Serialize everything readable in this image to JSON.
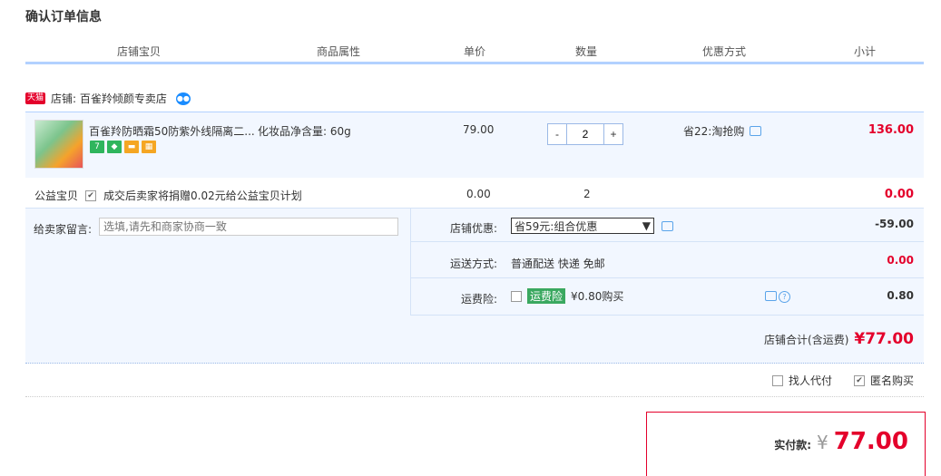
{
  "title": "确认订单信息",
  "columns": [
    "店铺宝贝",
    "商品属性",
    "单价",
    "数量",
    "优惠方式",
    "小计"
  ],
  "store": {
    "tag": "天猫",
    "label": "店铺: 百雀羚倾颜专卖店"
  },
  "item": {
    "name": "百雀羚防晒霜50防紫外线隔离二...",
    "attribute": "化妆品净含量: 60g",
    "price": "79.00",
    "qty_minus": "-",
    "qty_value": "2",
    "qty_plus": "+",
    "promo": "省22:淘抢购",
    "subtotal": "136.00",
    "icon_badge": "7"
  },
  "charity": {
    "label": "公益宝贝",
    "checkbox": "✔",
    "text": "成交后卖家将捐赠0.02元给公益宝贝计划",
    "price": "0.00",
    "qty": "2",
    "subtotal": "0.00"
  },
  "message": {
    "label": "给卖家留言:",
    "placeholder": "选填,请先和商家协商一致"
  },
  "store_discount": {
    "label": "店铺优惠:",
    "selected": "省59元:组合优惠",
    "value": "-59.00"
  },
  "shipping": {
    "label": "运送方式:",
    "value": "普通配送 快递 免邮",
    "fee": "0.00"
  },
  "insurance": {
    "label": "运费险:",
    "tag": "运费险",
    "text": "¥0.80购买",
    "fee": "0.80"
  },
  "store_total": {
    "label": "店铺合计(含运费)",
    "amount": "¥77.00"
  },
  "options": {
    "proxy_pay": "找人代付",
    "anonymous": "匿名购买",
    "anonymous_check": "✔"
  },
  "payment": {
    "label": "实付款:",
    "currency": "¥",
    "amount": "77.00"
  },
  "colors": {
    "accent": "#e4002b",
    "row_bg": "#f2f7ff",
    "border": "#b2d1ff"
  }
}
